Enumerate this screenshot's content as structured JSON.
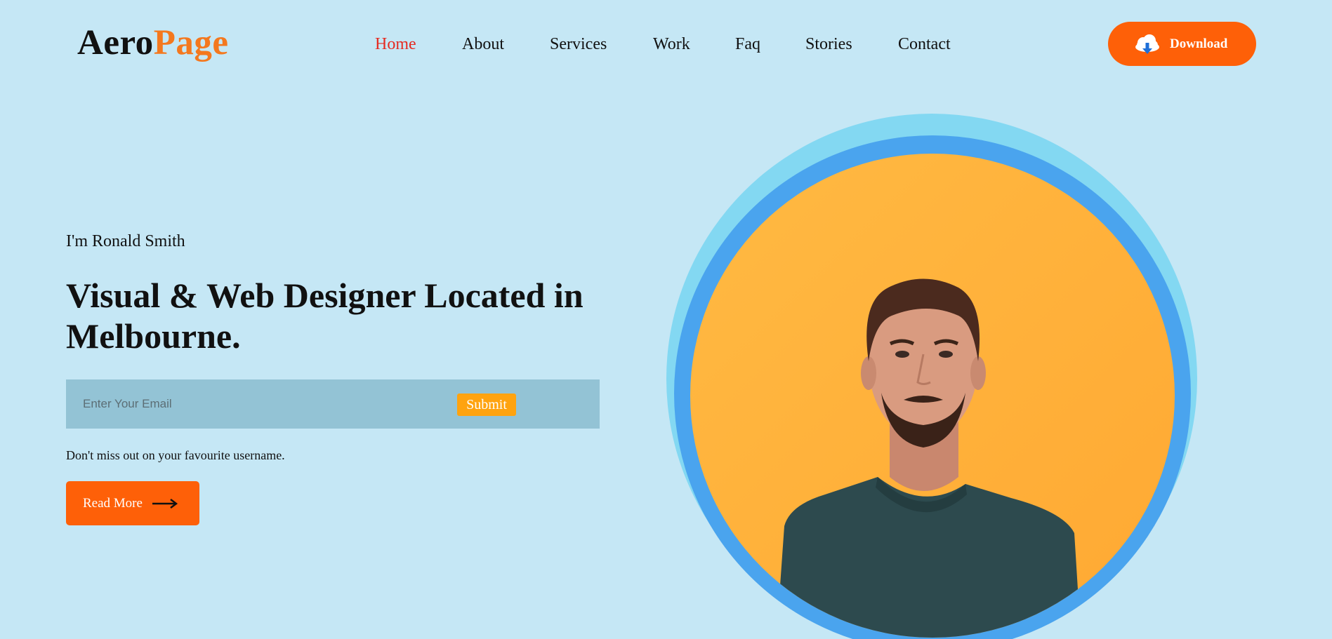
{
  "brand": {
    "part1": "Aero",
    "part2": "Page"
  },
  "nav": {
    "items": [
      {
        "label": "Home",
        "active": true
      },
      {
        "label": "About"
      },
      {
        "label": "Services"
      },
      {
        "label": "Work"
      },
      {
        "label": "Faq"
      },
      {
        "label": "Stories"
      },
      {
        "label": "Contact"
      }
    ]
  },
  "header": {
    "download_label": "Download",
    "download_icon": "cloud-download-icon"
  },
  "hero": {
    "intro": "I'm Ronald Smith",
    "title": "Visual & Web Designer Located in Melbourne.",
    "email_placeholder": "Enter Your Email",
    "email_value": "",
    "submit_label": "Submit",
    "note": "Don't miss out on your favourite username.",
    "read_more_label": "Read More",
    "read_more_icon": "arrow-right-icon"
  },
  "colors": {
    "background": "#c5e7f5",
    "accent": "#fe6008",
    "submit": "#ffa30f",
    "active_nav": "#e52b21",
    "circle_outer": "#83d8f2",
    "circle_mid": "#4aa4ee",
    "circle_inner": "#ffb641"
  }
}
